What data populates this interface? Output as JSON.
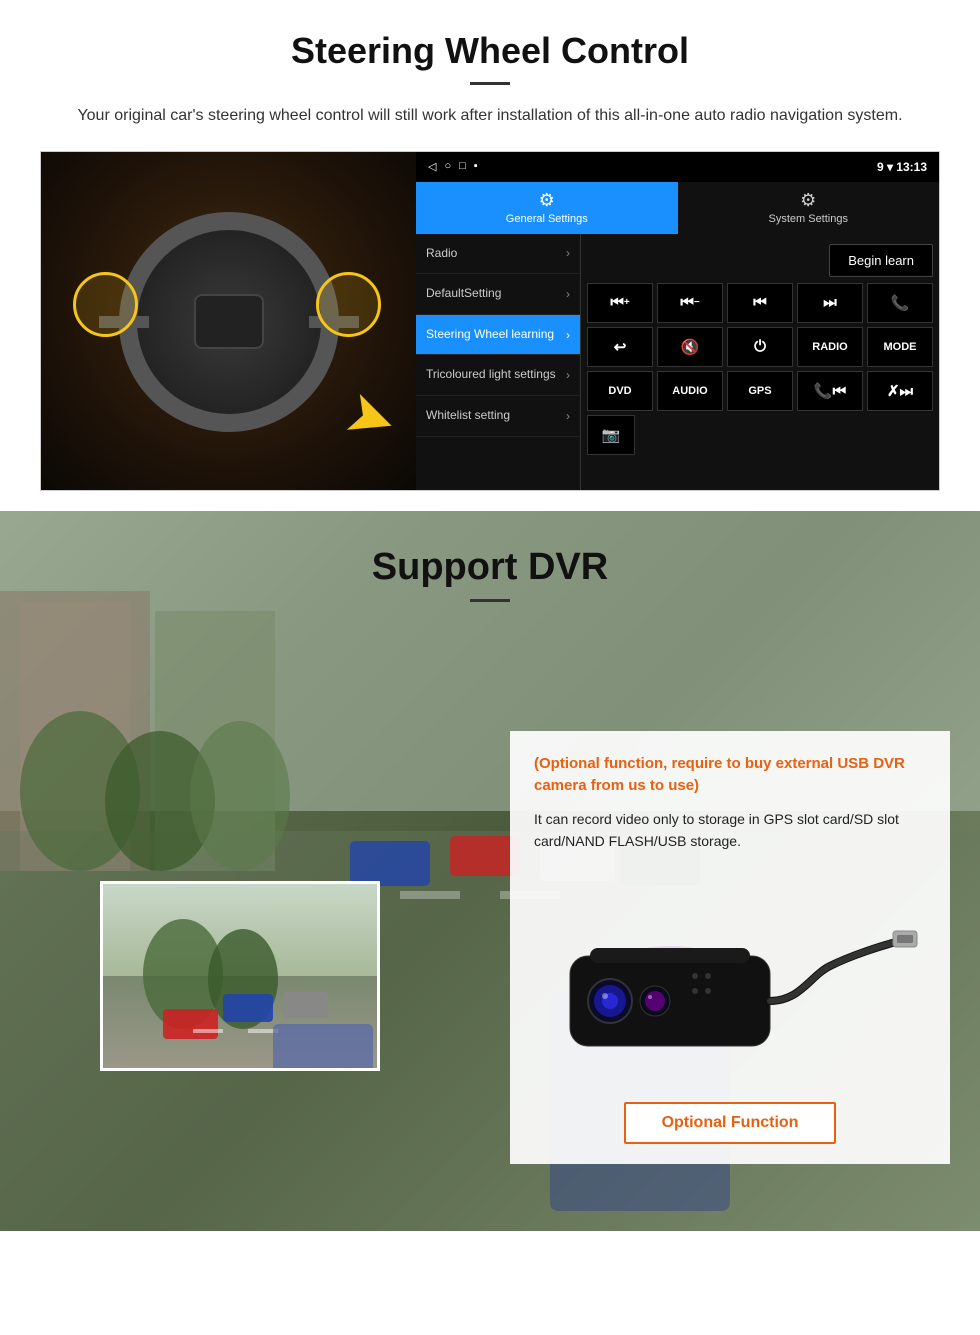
{
  "steering_section": {
    "title": "Steering Wheel Control",
    "subtitle": "Your original car's steering wheel control will still work after installation of this all-in-one auto radio navigation system.",
    "android_ui": {
      "statusbar": {
        "left_icons": [
          "◁",
          "○",
          "□",
          "▪"
        ],
        "right": "9 ▾ 13:13"
      },
      "tabs": [
        {
          "label": "General Settings",
          "icon": "⚙",
          "active": true
        },
        {
          "label": "System Settings",
          "icon": "🔧",
          "active": false
        }
      ],
      "menu_items": [
        {
          "label": "Radio",
          "active": false
        },
        {
          "label": "DefaultSetting",
          "active": false
        },
        {
          "label": "Steering Wheel learning",
          "active": true
        },
        {
          "label": "Tricoloured light settings",
          "active": false
        },
        {
          "label": "Whitelist setting",
          "active": false
        }
      ],
      "begin_learn_label": "Begin learn",
      "control_buttons_row1": [
        "⏮+",
        "⏮−",
        "⏮⏮",
        "⏭⏭",
        "📞"
      ],
      "control_buttons_row2": [
        "↩",
        "🔇×",
        "⏻",
        "RADIO",
        "MODE"
      ],
      "control_buttons_row3": [
        "DVD",
        "AUDIO",
        "GPS",
        "📞⏮",
        "✗⏭"
      ],
      "control_buttons_row4": [
        "📷"
      ]
    }
  },
  "dvr_section": {
    "title": "Support DVR",
    "optional_note": "(Optional function, require to buy external USB DVR camera from us to use)",
    "description": "It can record video only to storage in GPS slot card/SD slot card/NAND FLASH/USB storage.",
    "optional_function_label": "Optional Function"
  }
}
